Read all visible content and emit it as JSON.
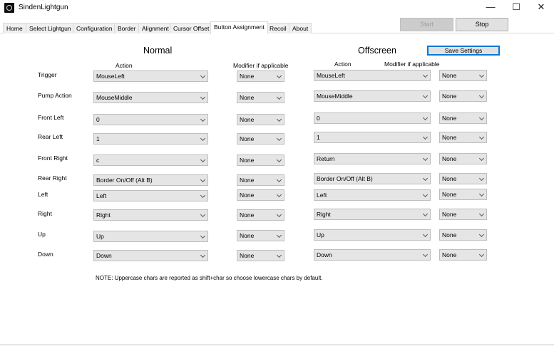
{
  "window": {
    "title": "SindenLightgun",
    "minimize": "—",
    "maximize": "☐",
    "close": "✕"
  },
  "tabs": [
    "Home",
    "Select Lightgun",
    "Configuration",
    "Border",
    "Alignment",
    "Cursor Offset",
    "Button Assignment",
    "Recoil",
    "About"
  ],
  "active_tab": "Button Assignment",
  "toolbar": {
    "start_label": "Start",
    "stop_label": "Stop"
  },
  "headings": {
    "normal": "Normal",
    "offscreen": "Offscreen",
    "action": "Action",
    "modifier": "Modifier if applicable",
    "save": "Save Settings"
  },
  "rows": [
    {
      "label": "Trigger",
      "normal_action": "MouseLeft",
      "normal_modifier": "None",
      "offscreen_action": "MouseLeft",
      "offscreen_modifier": "None"
    },
    {
      "label": "Pump Action",
      "normal_action": "MouseMiddle",
      "normal_modifier": "None",
      "offscreen_action": "MouseMiddle",
      "offscreen_modifier": "None"
    },
    {
      "label": "Front Left",
      "normal_action": "0",
      "normal_modifier": "None",
      "offscreen_action": "0",
      "offscreen_modifier": "None"
    },
    {
      "label": "Rear Left",
      "normal_action": "1",
      "normal_modifier": "None",
      "offscreen_action": "1",
      "offscreen_modifier": "None"
    },
    {
      "label": "Front Right",
      "normal_action": "c",
      "normal_modifier": "None",
      "offscreen_action": "Return",
      "offscreen_modifier": "None"
    },
    {
      "label": "Rear Right",
      "normal_action": "Border On/Off (Alt B)",
      "normal_modifier": "None",
      "offscreen_action": "Border On/Off (Alt B)",
      "offscreen_modifier": "None"
    },
    {
      "label": "Left",
      "normal_action": "Left",
      "normal_modifier": "None",
      "offscreen_action": "Left",
      "offscreen_modifier": "None"
    },
    {
      "label": "Right",
      "normal_action": "Right",
      "normal_modifier": "None",
      "offscreen_action": "Right",
      "offscreen_modifier": "None"
    },
    {
      "label": "Up",
      "normal_action": "Up",
      "normal_modifier": "None",
      "offscreen_action": "Up",
      "offscreen_modifier": "None"
    },
    {
      "label": "Down",
      "normal_action": "Down",
      "normal_modifier": "None",
      "offscreen_action": "Down",
      "offscreen_modifier": "None"
    }
  ],
  "note": "NOTE: Uppercase chars are reported as shift+char so choose lowercase chars by default."
}
